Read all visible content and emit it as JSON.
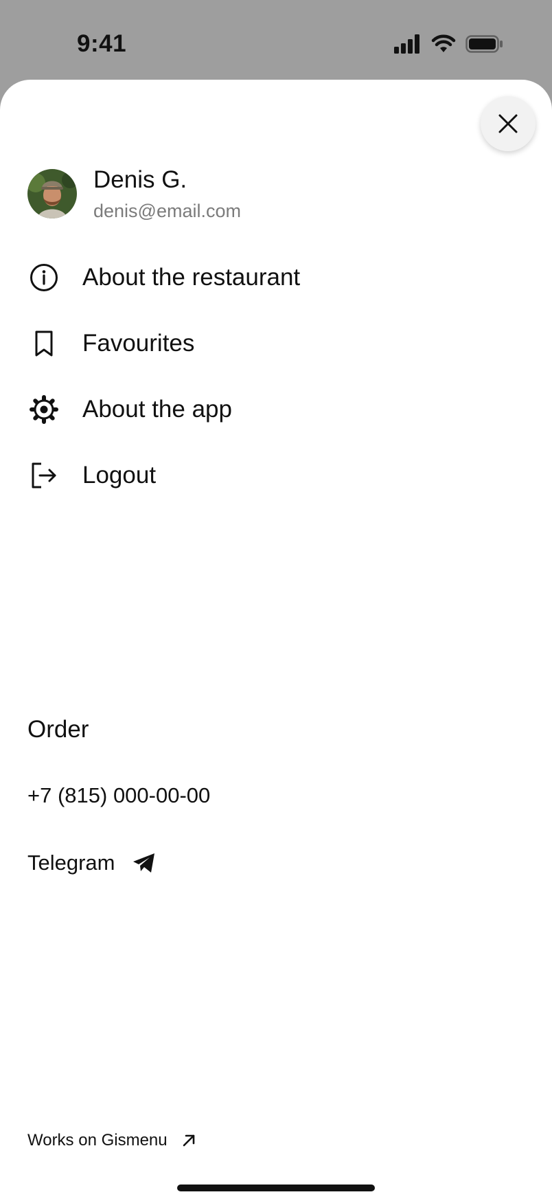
{
  "status_bar": {
    "time": "9:41",
    "icons": [
      "cellular-signal-icon",
      "wifi-icon",
      "battery-icon"
    ]
  },
  "profile": {
    "name": "Denis G.",
    "email": "denis@email.com"
  },
  "menu": {
    "items": [
      {
        "label": "About the restaurant",
        "icon": "info-icon"
      },
      {
        "label": "Favourites",
        "icon": "bookmark-icon"
      },
      {
        "label": "About the app",
        "icon": "gear-icon"
      },
      {
        "label": "Logout",
        "icon": "logout-icon"
      }
    ]
  },
  "order": {
    "title": "Order",
    "phone": "+7 (815) 000-00-00",
    "telegram_label": "Telegram"
  },
  "footer": {
    "link_label": "Works on Gismenu"
  },
  "colors": {
    "overlay": "#9e9e9e",
    "sheet": "#ffffff",
    "text": "#111111",
    "muted_text": "#7b7b7b",
    "close_button_bg": "#f2f2f2"
  }
}
